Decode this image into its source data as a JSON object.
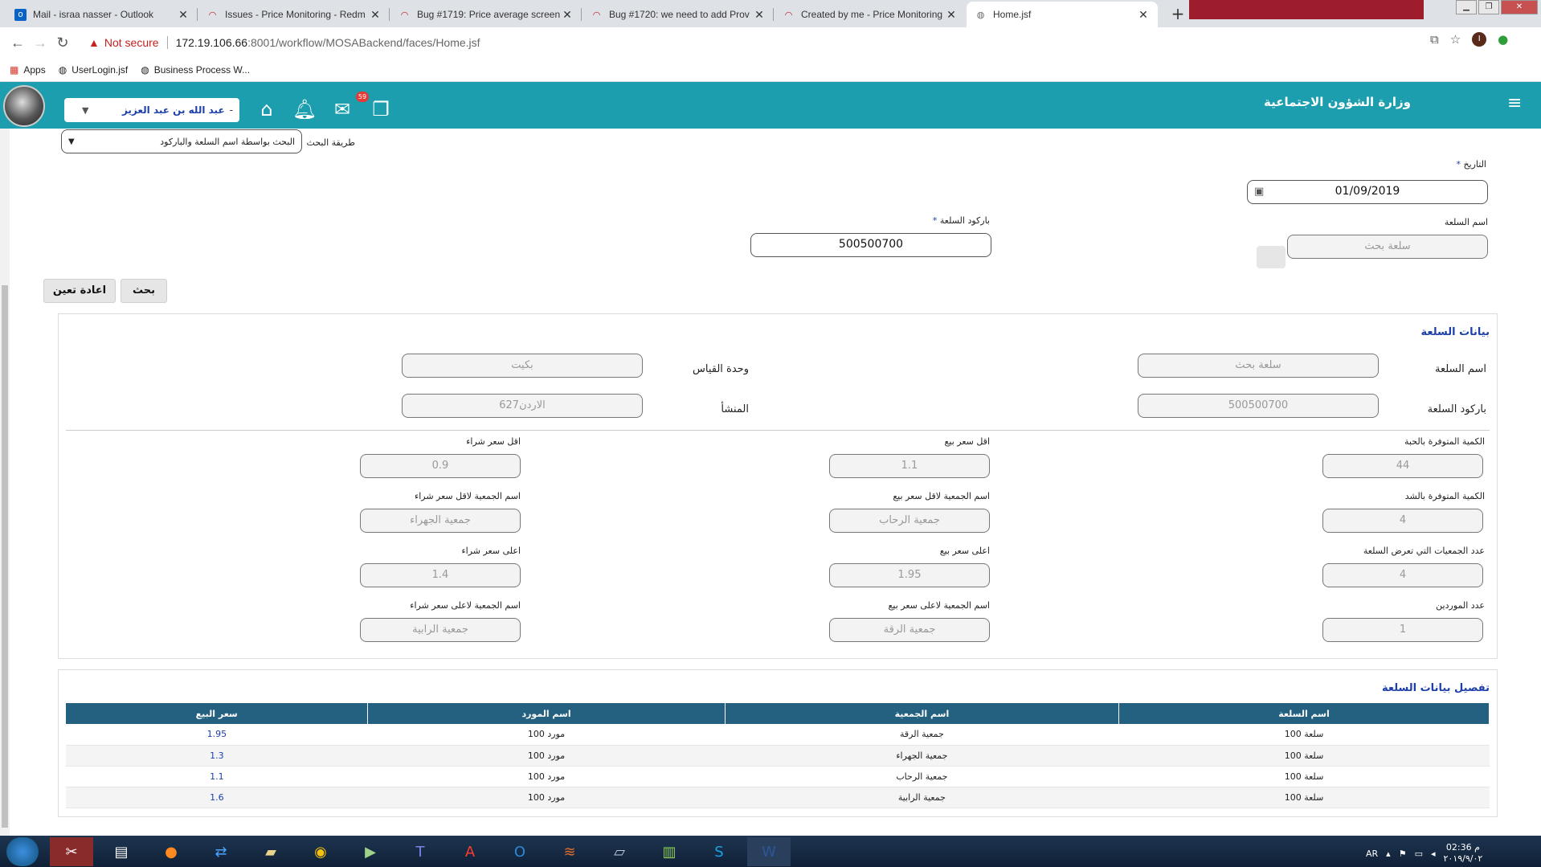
{
  "browser": {
    "tabs": [
      {
        "title": "Mail - israa nasser - Outlook",
        "icon": "outlook-icon"
      },
      {
        "title": "Issues - Price Monitoring - Redm",
        "icon": "redmine-icon"
      },
      {
        "title": "Bug #1719: Price average screen",
        "icon": "redmine-icon"
      },
      {
        "title": "Bug #1720: we need to add Prov",
        "icon": "redmine-icon"
      },
      {
        "title": "Created by me - Price Monitoring",
        "icon": "redmine-icon"
      },
      {
        "title": "Home.jsf",
        "icon": "globe-icon"
      }
    ],
    "new_tab": "+",
    "security_label": "Not secure",
    "url_host": "172.19.106.66",
    "url_path": ":8001/workflow/MOSABackend/faces/Home.jsf",
    "bookmarks": [
      "Apps",
      "UserLogin.jsf",
      "Business Process W..."
    ],
    "profile_initial": "I"
  },
  "header": {
    "user_name": "عبد الله بن عبد العزيز",
    "user_caret": "-",
    "ministry": "وزارة الشؤون الاجتماعية",
    "notif_count": "59",
    "color": "#1d9eae"
  },
  "search": {
    "method_label": "طريقة البحث",
    "method_value": "البحث بواسطة اسم السلعة والباركود",
    "date_label": "التاريخ",
    "date_value": "01/09/2019",
    "name_label": "اسم السلعة",
    "name_placeholder": "سلعة بحث",
    "barcode_label": "باركود السلعة",
    "barcode_value": "500500700",
    "required_mark": "*",
    "search_btn": "بحث",
    "reset_btn": "اعادة تعين"
  },
  "details": {
    "title": "بيانات السلعة",
    "name_label": "اسم السلعة",
    "name_value": "سلعة بحث",
    "unit_label": "وحدة القياس",
    "unit_value": "بكيت",
    "barcode_label": "باركود السلعة",
    "barcode_value": "500500700",
    "origin_label": "المنشأ",
    "origin_value": "الاردن627",
    "stats": [
      {
        "label": "الكمية المتوفرة بالحبة",
        "value": "44"
      },
      {
        "label": "اقل سعر بيع",
        "value": "1.1"
      },
      {
        "label": "اقل سعر شراء",
        "value": "0.9"
      },
      {
        "label": "الكمية المتوفرة بالشد",
        "value": "4"
      },
      {
        "label": "اسم الجمعية لاقل سعر بيع",
        "value": "جمعية الرحاب"
      },
      {
        "label": "اسم الجمعية لاقل سعر شراء",
        "value": "جمعية الجهراء"
      },
      {
        "label": "عدد الجمعيات التي تعرض السلعة",
        "value": "4"
      },
      {
        "label": "اعلى سعر بيع",
        "value": "1.95"
      },
      {
        "label": "اعلى سعر شراء",
        "value": "1.4"
      },
      {
        "label": "عدد الموردين",
        "value": "1"
      },
      {
        "label": "اسم الجمعية لاعلى سعر بيع",
        "value": "جمعية الرقة"
      },
      {
        "label": "اسم الجمعية لاعلى سعر شراء",
        "value": "جمعية الرابية"
      }
    ]
  },
  "table": {
    "title": "تفصيل بيانات السلعة",
    "headers": [
      "اسم السلعة",
      "اسم الجمعية",
      "اسم المورد",
      "سعر البيع"
    ],
    "rows": [
      [
        "سلعة 100",
        "جمعية الرقة",
        "مورد 100",
        "1.95"
      ],
      [
        "سلعة 100",
        "جمعية الجهراء",
        "مورد 100",
        "1.3"
      ],
      [
        "سلعة 100",
        "جمعية الرحاب",
        "مورد 100",
        "1.1"
      ],
      [
        "سلعة 100",
        "جمعية الرابية",
        "مورد 100",
        "1.6"
      ]
    ]
  },
  "taskbar": {
    "lang": "AR",
    "time": "02:36 م",
    "date": "٢٠١٩/٩/٠٢"
  }
}
